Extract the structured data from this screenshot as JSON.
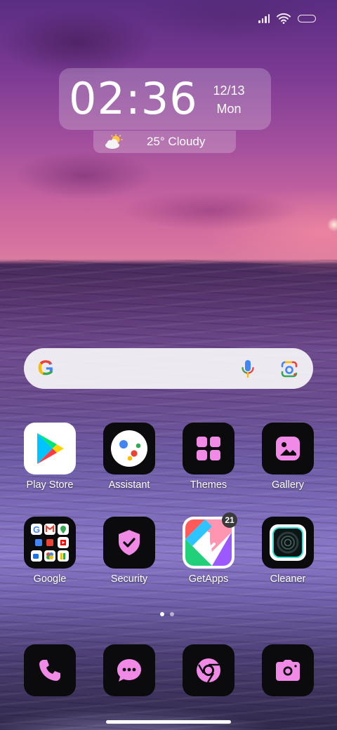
{
  "clock": {
    "time": "02:36",
    "date": "12/13",
    "weekday": "Mon"
  },
  "weather": {
    "text": "25° Cloudy",
    "icon": "partly-cloudy-icon"
  },
  "search": {
    "icons": [
      "google-g-icon",
      "microphone-icon",
      "google-lens-icon"
    ]
  },
  "apps": [
    {
      "label": "Play Store",
      "icon": "play-store-icon"
    },
    {
      "label": "Assistant",
      "icon": "assistant-icon"
    },
    {
      "label": "Themes",
      "icon": "themes-icon"
    },
    {
      "label": "Gallery",
      "icon": "gallery-icon"
    },
    {
      "label": "Google",
      "icon": "google-folder-icon"
    },
    {
      "label": "Security",
      "icon": "security-shield-icon"
    },
    {
      "label": "GetApps",
      "icon": "getapps-icon",
      "badge": "21"
    },
    {
      "label": "Cleaner",
      "icon": "cleaner-icon"
    }
  ],
  "dock": [
    {
      "icon": "phone-icon"
    },
    {
      "icon": "messages-icon"
    },
    {
      "icon": "chrome-icon"
    },
    {
      "icon": "camera-icon"
    }
  ],
  "pages": {
    "count": 2,
    "active": 1
  },
  "colors": {
    "accent": "#f08ae6",
    "tile": "#0b0a0c"
  }
}
